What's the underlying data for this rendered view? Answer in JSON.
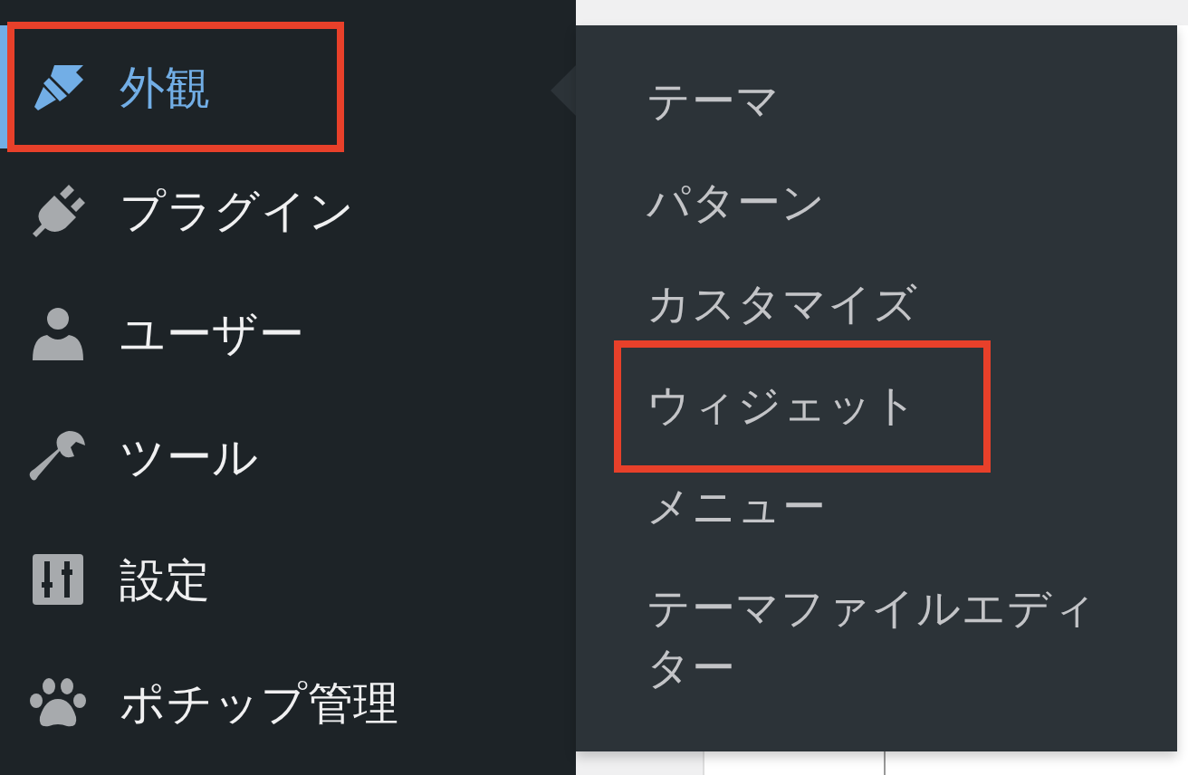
{
  "sidebar": {
    "items": [
      {
        "label": "外観",
        "selected": true,
        "highlighted": true
      },
      {
        "label": "プラグイン",
        "selected": false,
        "highlighted": false
      },
      {
        "label": "ユーザー",
        "selected": false,
        "highlighted": false
      },
      {
        "label": "ツール",
        "selected": false,
        "highlighted": false
      },
      {
        "label": "設定",
        "selected": false,
        "highlighted": false
      },
      {
        "label": "ポチップ管理",
        "selected": false,
        "highlighted": false
      }
    ]
  },
  "submenu": {
    "items": [
      {
        "label": "テーマ",
        "highlighted": false
      },
      {
        "label": "パターン",
        "highlighted": false
      },
      {
        "label": "カスタマイズ",
        "highlighted": false
      },
      {
        "label": "ウィジェット",
        "highlighted": true
      },
      {
        "label": "メニュー",
        "highlighted": false
      },
      {
        "label": "テーマファイルエディター",
        "highlighted": false
      }
    ]
  }
}
